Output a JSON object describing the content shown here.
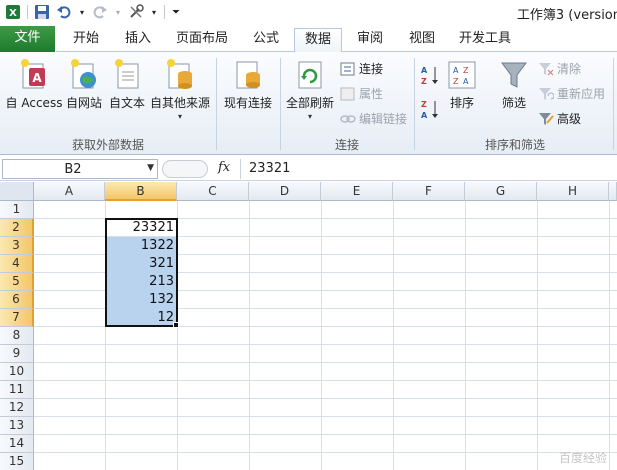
{
  "window": {
    "title": "工作簿3 (version"
  },
  "tabs": [
    {
      "label": "文件"
    },
    {
      "label": "开始"
    },
    {
      "label": "插入"
    },
    {
      "label": "页面布局"
    },
    {
      "label": "公式"
    },
    {
      "label": "数据"
    },
    {
      "label": "审阅"
    },
    {
      "label": "视图"
    },
    {
      "label": "开发工具"
    }
  ],
  "ribbon": {
    "external": {
      "access": "自 Access",
      "web": "自网站",
      "text": "自文本",
      "other": "自其他来源",
      "group": "获取外部数据"
    },
    "existing": "现有连接",
    "connections": {
      "refresh_all": "全部刷新",
      "connections": "连接",
      "properties": "属性",
      "edit_links": "编辑链接",
      "group": "连接"
    },
    "sort": {
      "sort": "排序",
      "filter": "筛选",
      "clear": "清除",
      "reapply": "重新应用",
      "advanced": "高级",
      "group": "排序和筛选"
    }
  },
  "formula_bar": {
    "name_box": "B2",
    "fx": "fx",
    "formula": "23321"
  },
  "grid": {
    "columns": [
      "A",
      "B",
      "C",
      "D",
      "E",
      "F",
      "G",
      "H"
    ],
    "rows": [
      "1",
      "2",
      "3",
      "4",
      "5",
      "6",
      "7",
      "8",
      "9",
      "10",
      "11",
      "12",
      "13",
      "14",
      "15"
    ],
    "cells": {
      "B2": "23321",
      "B3": "1322",
      "B4": "321",
      "B5": "213",
      "B6": "132",
      "B7": "12"
    }
  },
  "watermark": "百度经验",
  "colors": {
    "file_tab": "#2b8a3a",
    "selection": "#b9d3ee",
    "header_highlight": "#f3c66a"
  }
}
